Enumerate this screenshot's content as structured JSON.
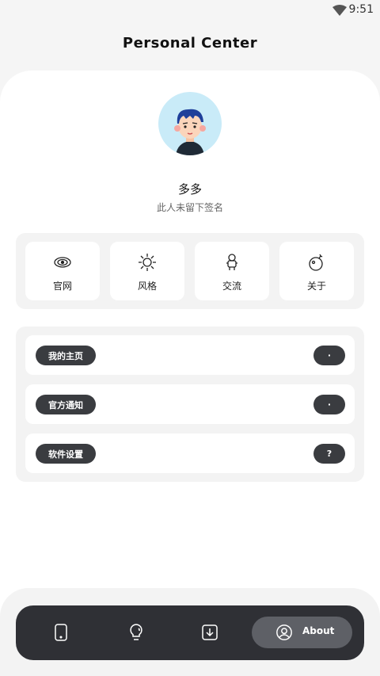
{
  "status_bar": {
    "time": "9:51",
    "wifi_icon": "wifi-icon"
  },
  "header": {
    "title": "Personal Center"
  },
  "profile": {
    "avatar_icon": "avatar-boy",
    "nickname": "多多",
    "signature": "此人未留下签名"
  },
  "quick_links": [
    {
      "icon": "galaxy-icon",
      "label": "官网"
    },
    {
      "icon": "sun-icon",
      "label": "风格"
    },
    {
      "icon": "astronaut-icon",
      "label": "交流"
    },
    {
      "icon": "bomb-icon",
      "label": "关于"
    }
  ],
  "menu": [
    {
      "label": "我的主页",
      "badge": "·"
    },
    {
      "label": "官方通知",
      "badge": "·"
    },
    {
      "label": "软件设置",
      "badge": "?"
    }
  ],
  "bottom_nav": {
    "items": [
      {
        "icon": "phone-icon"
      },
      {
        "icon": "lightbulb-icon"
      },
      {
        "icon": "download-icon"
      },
      {
        "icon": "user-circle-icon",
        "label": "About",
        "active": true
      }
    ]
  },
  "colors": {
    "dark": "#2f3035",
    "pill": "#3a3c40",
    "active_nav": "#5e6066",
    "avatar_bg": "#c9ebf8"
  }
}
